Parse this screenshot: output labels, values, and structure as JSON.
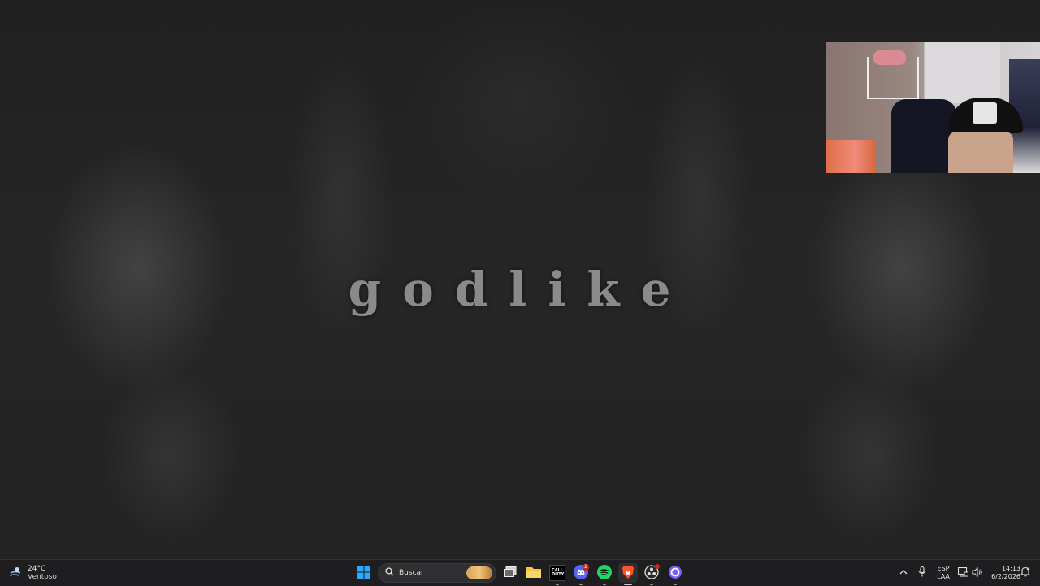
{
  "wallpaper": {
    "title": "godlike"
  },
  "webcam": {
    "visible": true
  },
  "taskbar": {
    "weather": {
      "temp": "24°C",
      "condition": "Ventoso",
      "icon": "wind-cloud-icon"
    },
    "search": {
      "placeholder": "Buscar",
      "icon": "search-icon"
    },
    "apps": [
      {
        "name": "start",
        "icon": "windows-logo-icon"
      },
      {
        "name": "task-view",
        "icon": "task-view-icon"
      },
      {
        "name": "file-explorer",
        "icon": "folder-icon"
      },
      {
        "name": "call-of-duty",
        "icon": "cod-icon",
        "label": "CALL DUTY",
        "running": true
      },
      {
        "name": "discord",
        "icon": "discord-icon",
        "badge": "2",
        "running": true
      },
      {
        "name": "spotify",
        "icon": "spotify-icon",
        "running": true
      },
      {
        "name": "brave",
        "icon": "brave-icon",
        "running": true,
        "active": true
      },
      {
        "name": "obs",
        "icon": "obs-icon",
        "running": true,
        "notify": true
      },
      {
        "name": "app-circle",
        "icon": "purple-circle-icon",
        "running": true
      }
    ],
    "tray": {
      "chevron": "chevron-up-icon",
      "mic": "microphone-icon",
      "lang_line1": "ESP",
      "lang_line2": "LAA",
      "display": "display-icon",
      "volume": "speaker-icon",
      "time": "14:13",
      "date": "6/2/2026",
      "notification": "notification-bell-icon"
    },
    "colors": {
      "windows_blue": "#29a8ff",
      "folder_yellow": "#f5c541",
      "spotify_green": "#1ed760",
      "discord_blurple": "#5865f2",
      "brave_orange": "#fb542b",
      "badge_red": "#c42b1c",
      "purple": "#7b5cff"
    }
  }
}
